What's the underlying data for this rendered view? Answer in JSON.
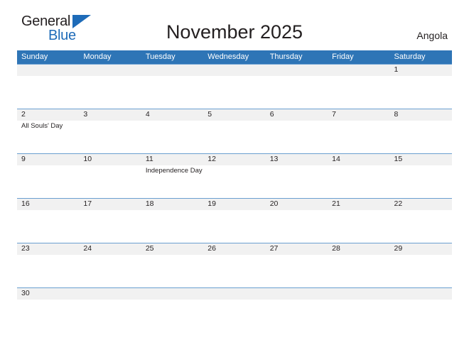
{
  "brand": {
    "name_part1": "General",
    "name_part2": "Blue",
    "triangle_icon": "blue-triangle-logo-mark",
    "color_dark": "#231f20",
    "color_blue": "#1e6bb8"
  },
  "header": {
    "title": "November 2025",
    "subtitle": "Angola"
  },
  "theme": {
    "header_blue": "#2e75b6",
    "row_separator_blue": "#6a9fd0",
    "number_band_gray": "#f1f1f1",
    "text_color": "#231f20"
  },
  "calendar": {
    "month": "November",
    "year": "2025",
    "country": "Angola",
    "weekday_headers": [
      "Sunday",
      "Monday",
      "Tuesday",
      "Wednesday",
      "Thursday",
      "Friday",
      "Saturday"
    ],
    "weeks": [
      {
        "days": [
          {
            "number": "",
            "event": ""
          },
          {
            "number": "",
            "event": ""
          },
          {
            "number": "",
            "event": ""
          },
          {
            "number": "",
            "event": ""
          },
          {
            "number": "",
            "event": ""
          },
          {
            "number": "",
            "event": ""
          },
          {
            "number": "1",
            "event": ""
          }
        ]
      },
      {
        "days": [
          {
            "number": "2",
            "event": "All Souls' Day"
          },
          {
            "number": "3",
            "event": ""
          },
          {
            "number": "4",
            "event": ""
          },
          {
            "number": "5",
            "event": ""
          },
          {
            "number": "6",
            "event": ""
          },
          {
            "number": "7",
            "event": ""
          },
          {
            "number": "8",
            "event": ""
          }
        ]
      },
      {
        "days": [
          {
            "number": "9",
            "event": ""
          },
          {
            "number": "10",
            "event": ""
          },
          {
            "number": "11",
            "event": "Independence Day"
          },
          {
            "number": "12",
            "event": ""
          },
          {
            "number": "13",
            "event": ""
          },
          {
            "number": "14",
            "event": ""
          },
          {
            "number": "15",
            "event": ""
          }
        ]
      },
      {
        "days": [
          {
            "number": "16",
            "event": ""
          },
          {
            "number": "17",
            "event": ""
          },
          {
            "number": "18",
            "event": ""
          },
          {
            "number": "19",
            "event": ""
          },
          {
            "number": "20",
            "event": ""
          },
          {
            "number": "21",
            "event": ""
          },
          {
            "number": "22",
            "event": ""
          }
        ]
      },
      {
        "days": [
          {
            "number": "23",
            "event": ""
          },
          {
            "number": "24",
            "event": ""
          },
          {
            "number": "25",
            "event": ""
          },
          {
            "number": "26",
            "event": ""
          },
          {
            "number": "27",
            "event": ""
          },
          {
            "number": "28",
            "event": ""
          },
          {
            "number": "29",
            "event": ""
          }
        ]
      },
      {
        "days": [
          {
            "number": "30",
            "event": ""
          },
          {
            "number": "",
            "event": ""
          },
          {
            "number": "",
            "event": ""
          },
          {
            "number": "",
            "event": ""
          },
          {
            "number": "",
            "event": ""
          },
          {
            "number": "",
            "event": ""
          },
          {
            "number": "",
            "event": ""
          }
        ]
      }
    ]
  }
}
